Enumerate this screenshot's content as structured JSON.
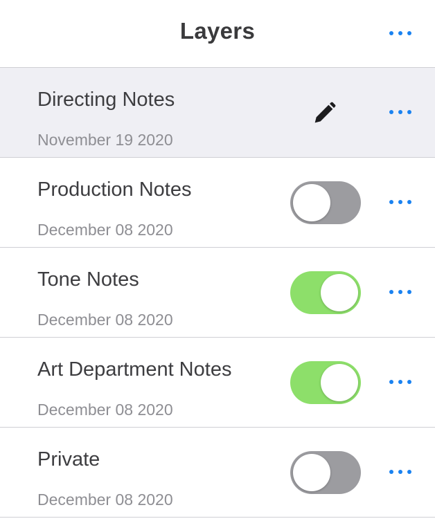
{
  "header": {
    "title": "Layers",
    "more_icon": "more-horizontal-icon"
  },
  "colors": {
    "accent": "#1a82f0",
    "toggle_on": "#8ddf6a",
    "toggle_off": "#9c9ca0",
    "selected_row": "#efeff4"
  },
  "layers": [
    {
      "name": "Directing Notes",
      "date": "November 19 2020",
      "control": "edit",
      "icon": "pencil-icon",
      "selected": true
    },
    {
      "name": "Production Notes",
      "date": "December 08 2020",
      "control": "toggle",
      "enabled": false
    },
    {
      "name": "Tone Notes",
      "date": "December 08 2020",
      "control": "toggle",
      "enabled": true
    },
    {
      "name": "Art Department Notes",
      "date": "December 08 2020",
      "control": "toggle",
      "enabled": true
    },
    {
      "name": "Private",
      "date": "December 08 2020",
      "control": "toggle",
      "enabled": false
    }
  ]
}
